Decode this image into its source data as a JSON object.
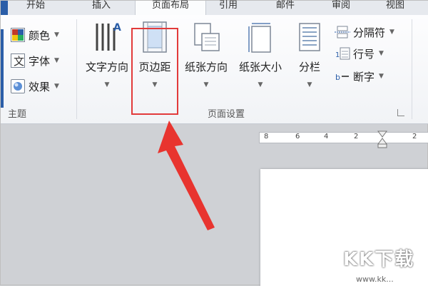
{
  "tabs": [
    "开始",
    "插入",
    "页面布局",
    "引用",
    "邮件",
    "审阅",
    "视图"
  ],
  "theme_group": {
    "items": [
      "颜色",
      "字体",
      "效果"
    ],
    "label": "主题"
  },
  "page_setup": {
    "text_direction": "文字方向",
    "margins": "页边距",
    "orientation": "纸张方向",
    "size": "纸张大小",
    "columns": "分栏",
    "breaks": "分隔符",
    "line_numbers": "行号",
    "hyphenation": "断字",
    "label": "页面设置"
  },
  "ruler": {
    "ticks": [
      "8",
      "6",
      "4",
      "2",
      "2"
    ]
  },
  "watermark": {
    "logo": "KK下载",
    "url": "www.kk..."
  },
  "colors": {
    "highlight": "#e23a3a",
    "arrow": "#e8342f",
    "accent": "#2b5ea8"
  }
}
